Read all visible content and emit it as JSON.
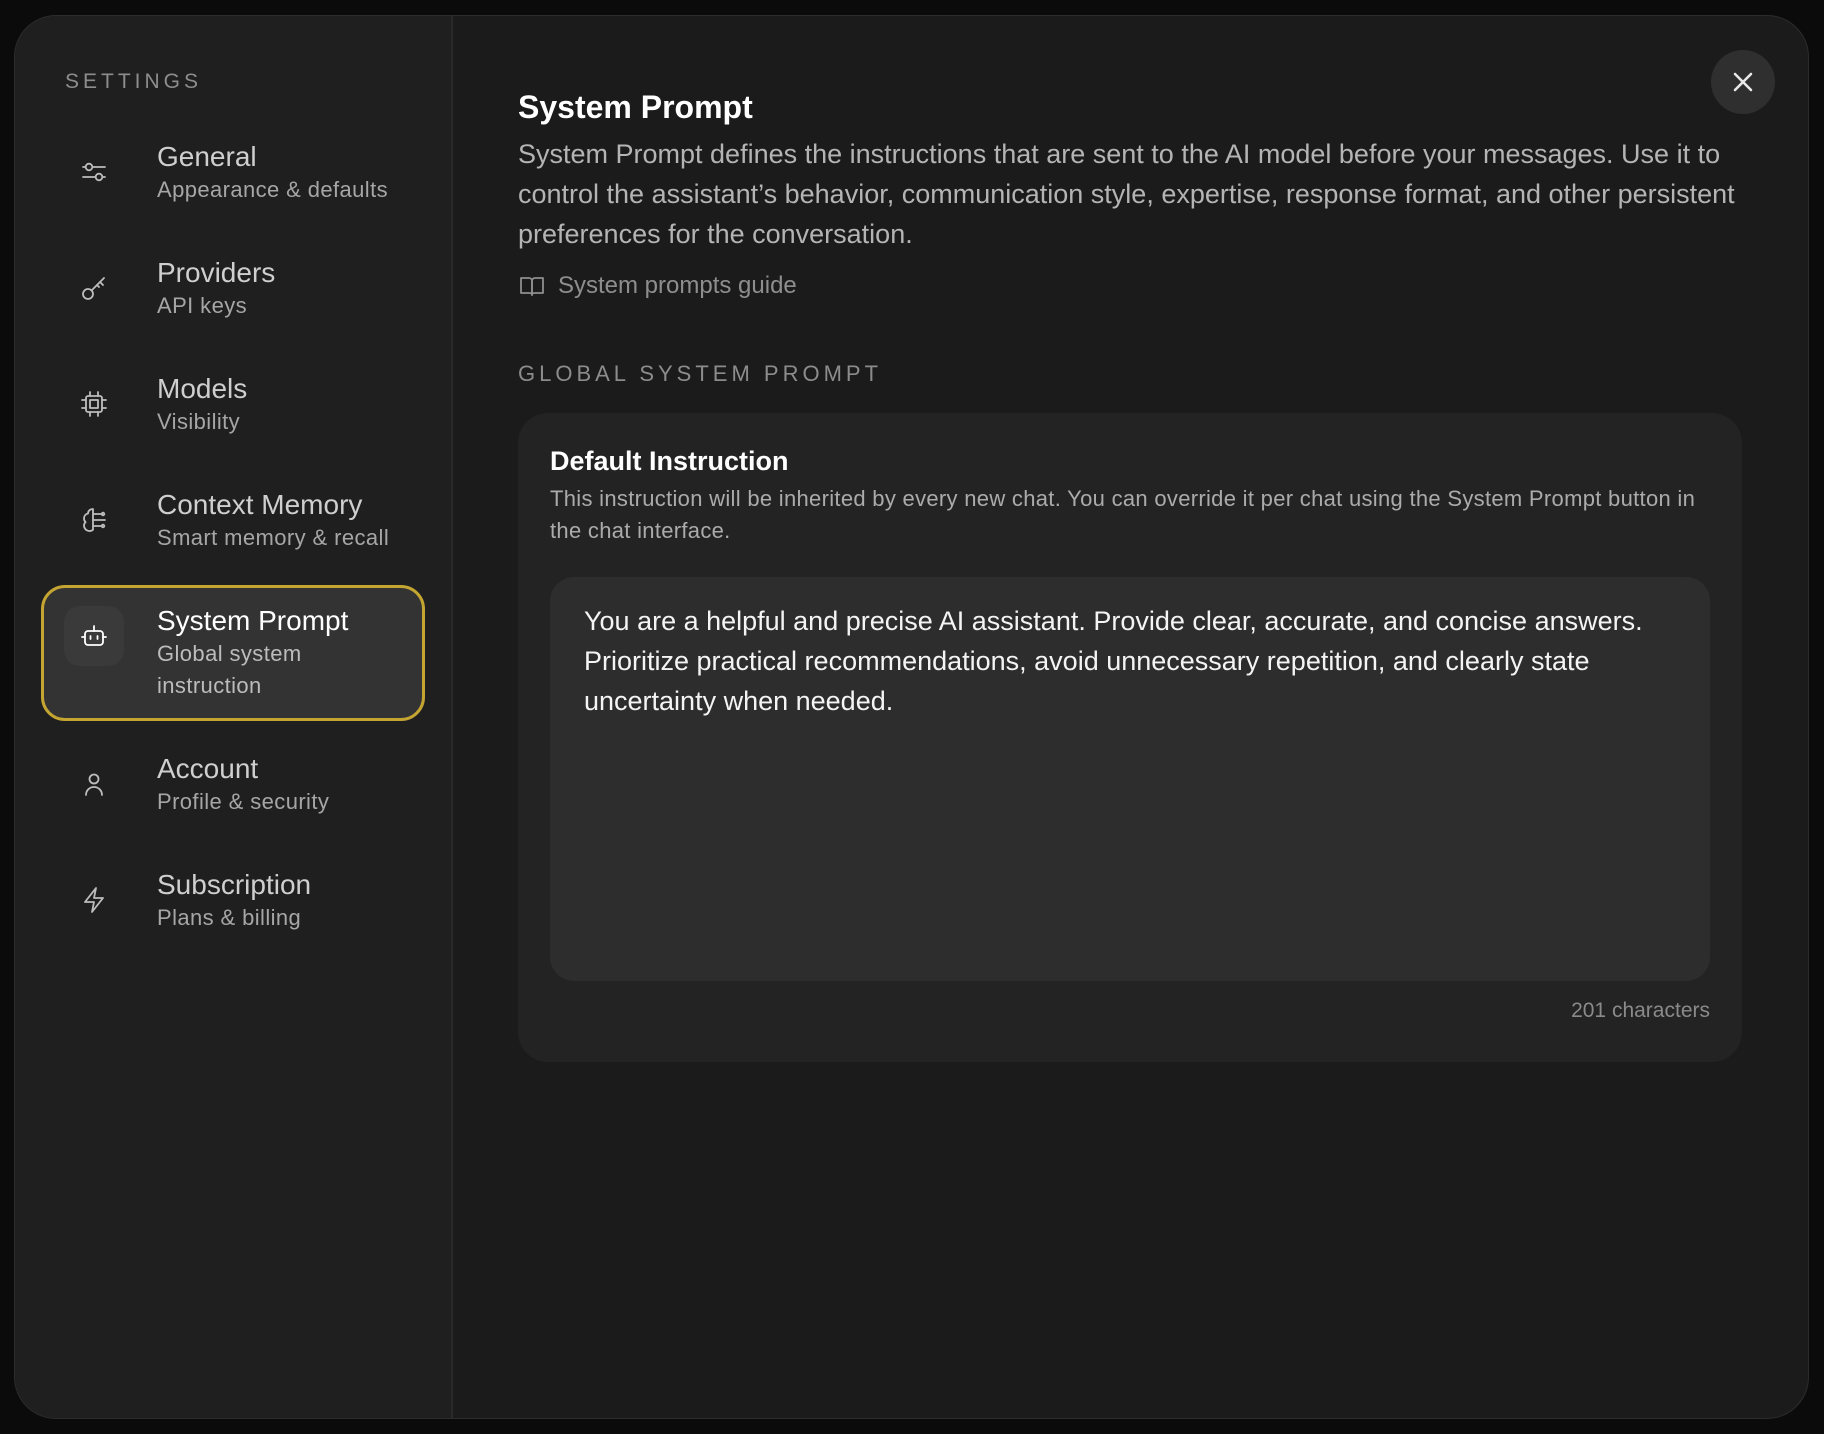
{
  "sidebar": {
    "heading": "SETTINGS",
    "items": [
      {
        "title": "General",
        "subtitle": "Appearance & defaults",
        "icon": "sliders-icon"
      },
      {
        "title": "Providers",
        "subtitle": "API keys",
        "icon": "key-icon"
      },
      {
        "title": "Models",
        "subtitle": "Visibility",
        "icon": "chip-icon"
      },
      {
        "title": "Context Memory",
        "subtitle": "Smart memory & recall",
        "icon": "brain-icon"
      },
      {
        "title": "System Prompt",
        "subtitle": "Global system instruction",
        "icon": "bot-icon",
        "active": true
      },
      {
        "title": "Account",
        "subtitle": "Profile & security",
        "icon": "user-icon"
      },
      {
        "title": "Subscription",
        "subtitle": "Plans & billing",
        "icon": "lightning-icon"
      }
    ]
  },
  "main": {
    "title": "System Prompt",
    "description": "System Prompt defines the instructions that are sent to the AI model before your messages. Use it to control the assistant’s behavior, communication style, expertise, response format, and other persistent preferences for the conversation.",
    "guide_link": "System prompts guide",
    "section_label": "GLOBAL SYSTEM PROMPT",
    "card": {
      "title": "Default Instruction",
      "description": "This instruction will be inherited by every new chat. You can override it per chat using the System Prompt button in the chat interface.",
      "prompt_text": "You are a helpful and precise AI assistant. Provide clear, accurate, and concise answers. Prioritize practical recommendations, avoid unnecessary repetition, and clearly state uncertainty when needed.",
      "char_count": "201 characters"
    }
  },
  "colors": {
    "accent_border": "#c5a532",
    "background": "#1b1b1b",
    "sidebar": "#1f1f1f"
  }
}
